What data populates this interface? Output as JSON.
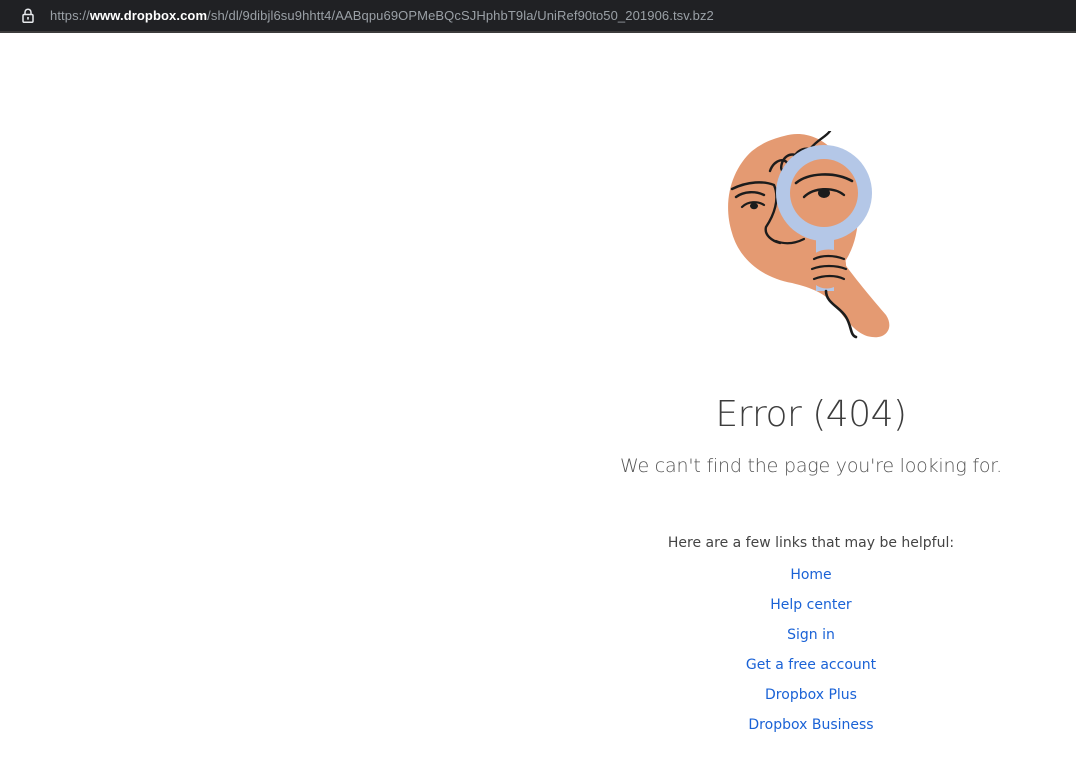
{
  "address_bar": {
    "url_scheme": "https://",
    "url_host": "www.dropbox.com",
    "url_path": "/sh/dl/9dibjl6su9hhtt4/AABqpu69OPMeBQcSJHphbT9la/UniRef90to50_201906.tsv.bz2",
    "lock_icon": "lock-icon"
  },
  "error": {
    "title": "Error (404)",
    "subtitle": "We can't find the page you're looking for."
  },
  "help": {
    "intro": "Here are a few links that may be helpful:",
    "links": [
      {
        "label": "Home"
      },
      {
        "label": "Help center"
      },
      {
        "label": "Sign in"
      },
      {
        "label": "Get a free account"
      },
      {
        "label": "Dropbox Plus"
      },
      {
        "label": "Dropbox Business"
      }
    ]
  },
  "colors": {
    "bar_bg": "#202124",
    "link": "#1a62d6",
    "skin": "#e49a72",
    "glass": "#b4c7e7"
  }
}
